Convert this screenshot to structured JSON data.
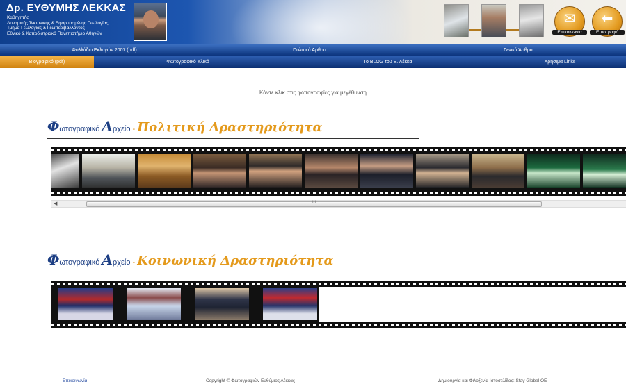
{
  "header": {
    "name": "Δρ. ΕΥΘΥΜΗΣ ΛΕΚΚΑΣ",
    "subtitles": [
      "Καθηγητής",
      "Δυναμικής Τεκτονικής & Εφαρμοσμένης Γεωλογίας",
      "Τμήμα Γεωλογίας & Γεωπεριβάλλοντος",
      "Εθνικό & Καποδιστριακό Πανεπιστήμιο Αθηνών"
    ],
    "contact_label": "Επικοινωνία",
    "back_label": "Επιστροφή"
  },
  "nav_top": [
    {
      "label": "Φυλλάδιο Εκλογών 2007 (pdf)"
    },
    {
      "label": "Πολιτικά Άρθρα"
    },
    {
      "label": "Γενικά Άρθρα"
    }
  ],
  "nav_bottom": [
    {
      "label": "Βιογραφικό (pdf)",
      "active": true
    },
    {
      "label": "Φωτογραφικό Υλικό"
    },
    {
      "label": "Το BLOG του Ε. Λέκκα"
    },
    {
      "label": "Χρήσιμα Links"
    }
  ],
  "caption": "Κάντε κλικ στις φωτογραφίες για μεγέθυνση",
  "sections": [
    {
      "title_big_1": "Φ",
      "title_small_1": "ωτογραφικό ",
      "title_big_2": "Α",
      "title_small_2": "ρχείο",
      "title_dash": " - ",
      "title_highlight": "Πολιτική Δραστηριότητα"
    },
    {
      "title_big_1": "Φ",
      "title_small_1": "ωτογραφικό ",
      "title_big_2": "Α",
      "title_small_2": "ρχείο",
      "title_dash": " - ",
      "title_highlight": "Κοινωνική Δραστηριότητα"
    }
  ],
  "scrollbar_grip": "III",
  "footer": {
    "contact": "Επικοινωνία",
    "copyright": "Copyright © Φωτογραφιών Ευθύμιος Λέκκας",
    "credit": "Δημιουργία και Φιλοξενία Ιστοσελίδας: Stay Global OE"
  }
}
